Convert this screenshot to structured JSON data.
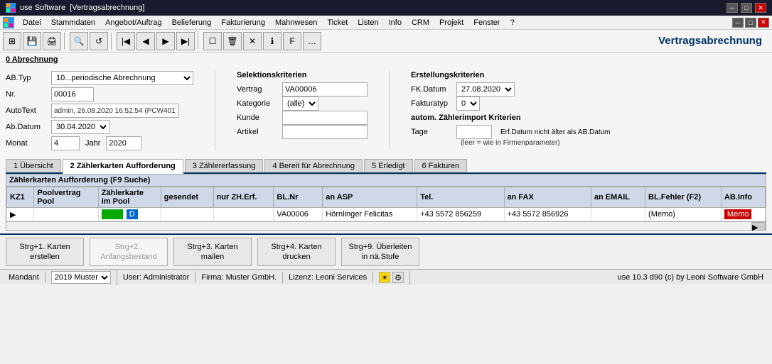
{
  "titleBar": {
    "appName": "use Software",
    "windowTitle": "[Vertragsabrechnung]",
    "minimizeLabel": "─",
    "maximizeLabel": "□",
    "closeLabel": "✕"
  },
  "menuBar": {
    "items": [
      {
        "label": "Datei"
      },
      {
        "label": "Stammdaten"
      },
      {
        "label": "Angebot/Auftrag"
      },
      {
        "label": "Belieferung"
      },
      {
        "label": "Fakturierung"
      },
      {
        "label": "Mahnwesen"
      },
      {
        "label": "Ticket"
      },
      {
        "label": "Listen"
      },
      {
        "label": "Info"
      },
      {
        "label": "CRM"
      },
      {
        "label": "Projekt"
      },
      {
        "label": "Fenster"
      },
      {
        "label": "?"
      }
    ]
  },
  "toolbar": {
    "title": "Vertragsabrechnung",
    "buttons": [
      "⊞",
      "💾",
      "🖨",
      "🔍",
      "🔄",
      "⏮",
      "◀",
      "▶",
      "⏭",
      "⬜",
      "🗑",
      "✕",
      "ℹ",
      "F",
      "…"
    ]
  },
  "form": {
    "sectionHeader": "0 Abrechnung",
    "abTypLabel": "AB.Typ",
    "abTypValue": "10...periodische Abrechnung",
    "nrLabel": "Nr.",
    "nrValue": "00016",
    "autoTextLabel": "AutoText",
    "autoTextValue": "admin, 26.08.2020 16:52:54 (PCW401)",
    "abDatumLabel": "Ab.Datum",
    "abDatumValue": "30.04.2020",
    "monatLabel": "Monat",
    "monatValue": "4",
    "jahrLabel": "Jahr",
    "jahrValue": "2020",
    "selectionCriteria": {
      "title": "Selektionskriterien",
      "vertragLabel": "Vertrag",
      "vertragValue": "VA00006",
      "kategorieLabel": "Kategorie",
      "kategorieValue": "(alle)",
      "kundeLabel": "Kunde",
      "kundeValue": "",
      "artikelLabel": "Artikel",
      "artikelValue": ""
    },
    "creationCriteria": {
      "title": "Erstellungskriterien",
      "fkDatumLabel": "FK.Datum",
      "fkDatumValue": "27.08.2020",
      "fakturaTypLabel": "Fakturatyp",
      "fakturaTypValue": "0",
      "zaehlerImportTitle": "autom. Zählerimport Kriterien",
      "tageLabel": "Tage",
      "tageValue": "",
      "erfDatumText": "Erf.Datum nicht älter als AB.Datum",
      "leerText": "(leer = wie in Firmenparameter)"
    }
  },
  "tabs": [
    {
      "label": "1 Übersicht",
      "active": false
    },
    {
      "label": "2 Zählerkarten Aufforderung",
      "active": true
    },
    {
      "label": "3 Zählererfassung",
      "active": false
    },
    {
      "label": "4 Bereit für Abrechnung",
      "active": false
    },
    {
      "label": "5 Erledigt",
      "active": false
    },
    {
      "label": "6 Fakturen",
      "active": false
    }
  ],
  "tableSection": {
    "header": "Zählerkarten Aufforderung (F9 Suche)",
    "columns": [
      "KZ1",
      "Poolvertrag Pool",
      "Zählerkarte im Pool",
      "gesendet",
      "nur ZH.Erf.",
      "BL.Nr",
      "an ASP",
      "Tel.",
      "an FAX",
      "an EMAIL",
      "BL.Fehler (F2)",
      "AB.Info"
    ],
    "rows": [
      {
        "kz1": "▶",
        "poolvertrag": "",
        "zaehlerkarte": "D",
        "gesendet": "",
        "nurZhErf": "",
        "blNr": "VA00006",
        "anAsp": "Hörnlinger Felicitas",
        "tel": "+43 5572 856259",
        "anFax": "+43 5572 856926",
        "anEmail": "",
        "blFehler": "(Memo)",
        "abInfo": "Memo"
      }
    ]
  },
  "bottomButtons": [
    {
      "label": "Strg+1. Karten\nerstellen",
      "disabled": false
    },
    {
      "label": "Strg+2..\nAnfangsbestand",
      "disabled": true
    },
    {
      "label": "Strg+3. Karten\nmailen",
      "disabled": false
    },
    {
      "label": "Strg+4. Karten\ndrucken",
      "disabled": false
    },
    {
      "label": "Strg+9. Überleiten\nin nä.Stufe",
      "disabled": false
    }
  ],
  "statusBar": {
    "mandantLabel": "Mandant",
    "mandantValue": "2019 Muster",
    "userLabel": "User: Administrator",
    "firmaLabel": "Firma: Muster GmbH.",
    "lizenzLabel": "Lizenz: Leoni Services",
    "versionLabel": "use 10.3 d90 (c) by Leoni Software GmbH"
  }
}
